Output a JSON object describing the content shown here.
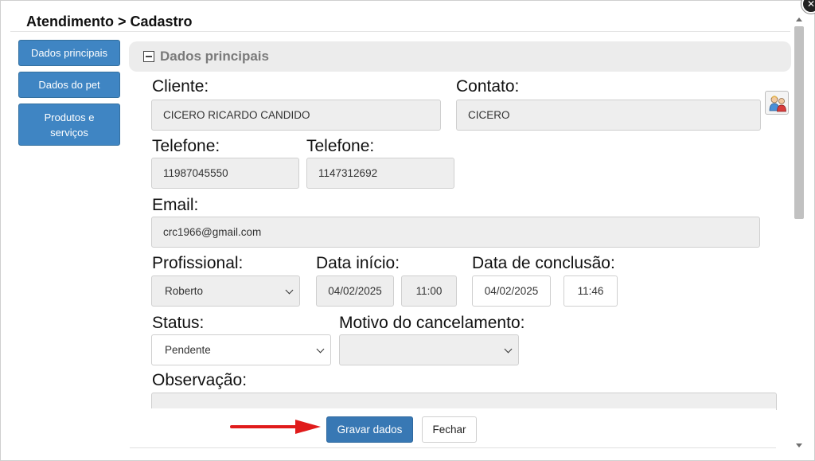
{
  "header": {
    "title": "Atendimento > Cadastro"
  },
  "sidebar": {
    "items": [
      {
        "label": "Dados principais"
      },
      {
        "label": "Dados do pet"
      },
      {
        "label": "Produtos e serviços"
      }
    ]
  },
  "section": {
    "title": "Dados principais",
    "collapse_icon": "minus-square-icon"
  },
  "form": {
    "cliente": {
      "label": "Cliente:",
      "value": "CICERO RICARDO CANDIDO"
    },
    "contato": {
      "label": "Contato:",
      "value": "CICERO",
      "icon": "contacts-icon"
    },
    "telefone1": {
      "label": "Telefone:",
      "value": "11987045550"
    },
    "telefone2": {
      "label": "Telefone:",
      "value": "1147312692"
    },
    "email": {
      "label": "Email:",
      "value": "crc1966@gmail.com"
    },
    "profissional": {
      "label": "Profissional:",
      "value": "Roberto"
    },
    "data_inicio": {
      "label": "Data início:",
      "date": "04/02/2025",
      "time": "11:00"
    },
    "data_conclusao": {
      "label": "Data de conclusão:",
      "date": "04/02/2025",
      "time": "11:46"
    },
    "status": {
      "label": "Status:",
      "value": "Pendente"
    },
    "motivo_cancelamento": {
      "label": "Motivo do cancelamento:",
      "value": ""
    },
    "observacao": {
      "label": "Observação:",
      "value": ""
    }
  },
  "footer": {
    "save_label": "Gravar dados",
    "close_label": "Fechar"
  },
  "annotation": {
    "color": "#e01b1b"
  },
  "colors": {
    "primary": "#3878b4",
    "nav": "#3f85c3"
  }
}
